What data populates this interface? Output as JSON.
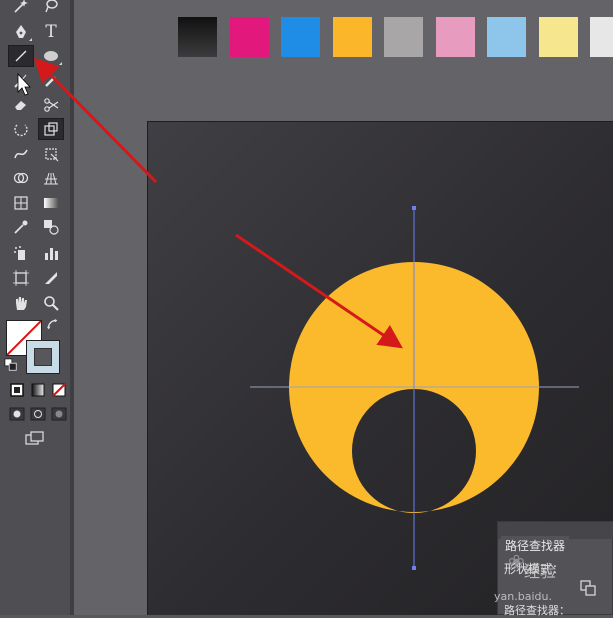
{
  "swatches": [
    {
      "name": "black-gradient",
      "color": "#2b2b2d"
    },
    {
      "name": "magenta",
      "color": "#e3187d"
    },
    {
      "name": "blue",
      "color": "#1f8ce5"
    },
    {
      "name": "orange",
      "color": "#fbb62a"
    },
    {
      "name": "gray",
      "color": "#a8a6a7"
    },
    {
      "name": "pink",
      "color": "#e79bbf"
    },
    {
      "name": "light-blue",
      "color": "#8dc6ea"
    },
    {
      "name": "light-yellow",
      "color": "#f6e78e"
    },
    {
      "name": "light-gray",
      "color": "#e7e7e7"
    }
  ],
  "tools": {
    "type_glyph": "T"
  },
  "colors": {
    "accent_orange": "#fbb92c",
    "guide_line": "#6e7ff0",
    "arrow": "#d4191b"
  },
  "pathfinder": {
    "tab_label": "路径查找器",
    "shape_modes_label": "形状模式：",
    "pathfinders_label": "路径查找器："
  },
  "watermark": {
    "text": "经验",
    "url": "yan.baidu."
  }
}
